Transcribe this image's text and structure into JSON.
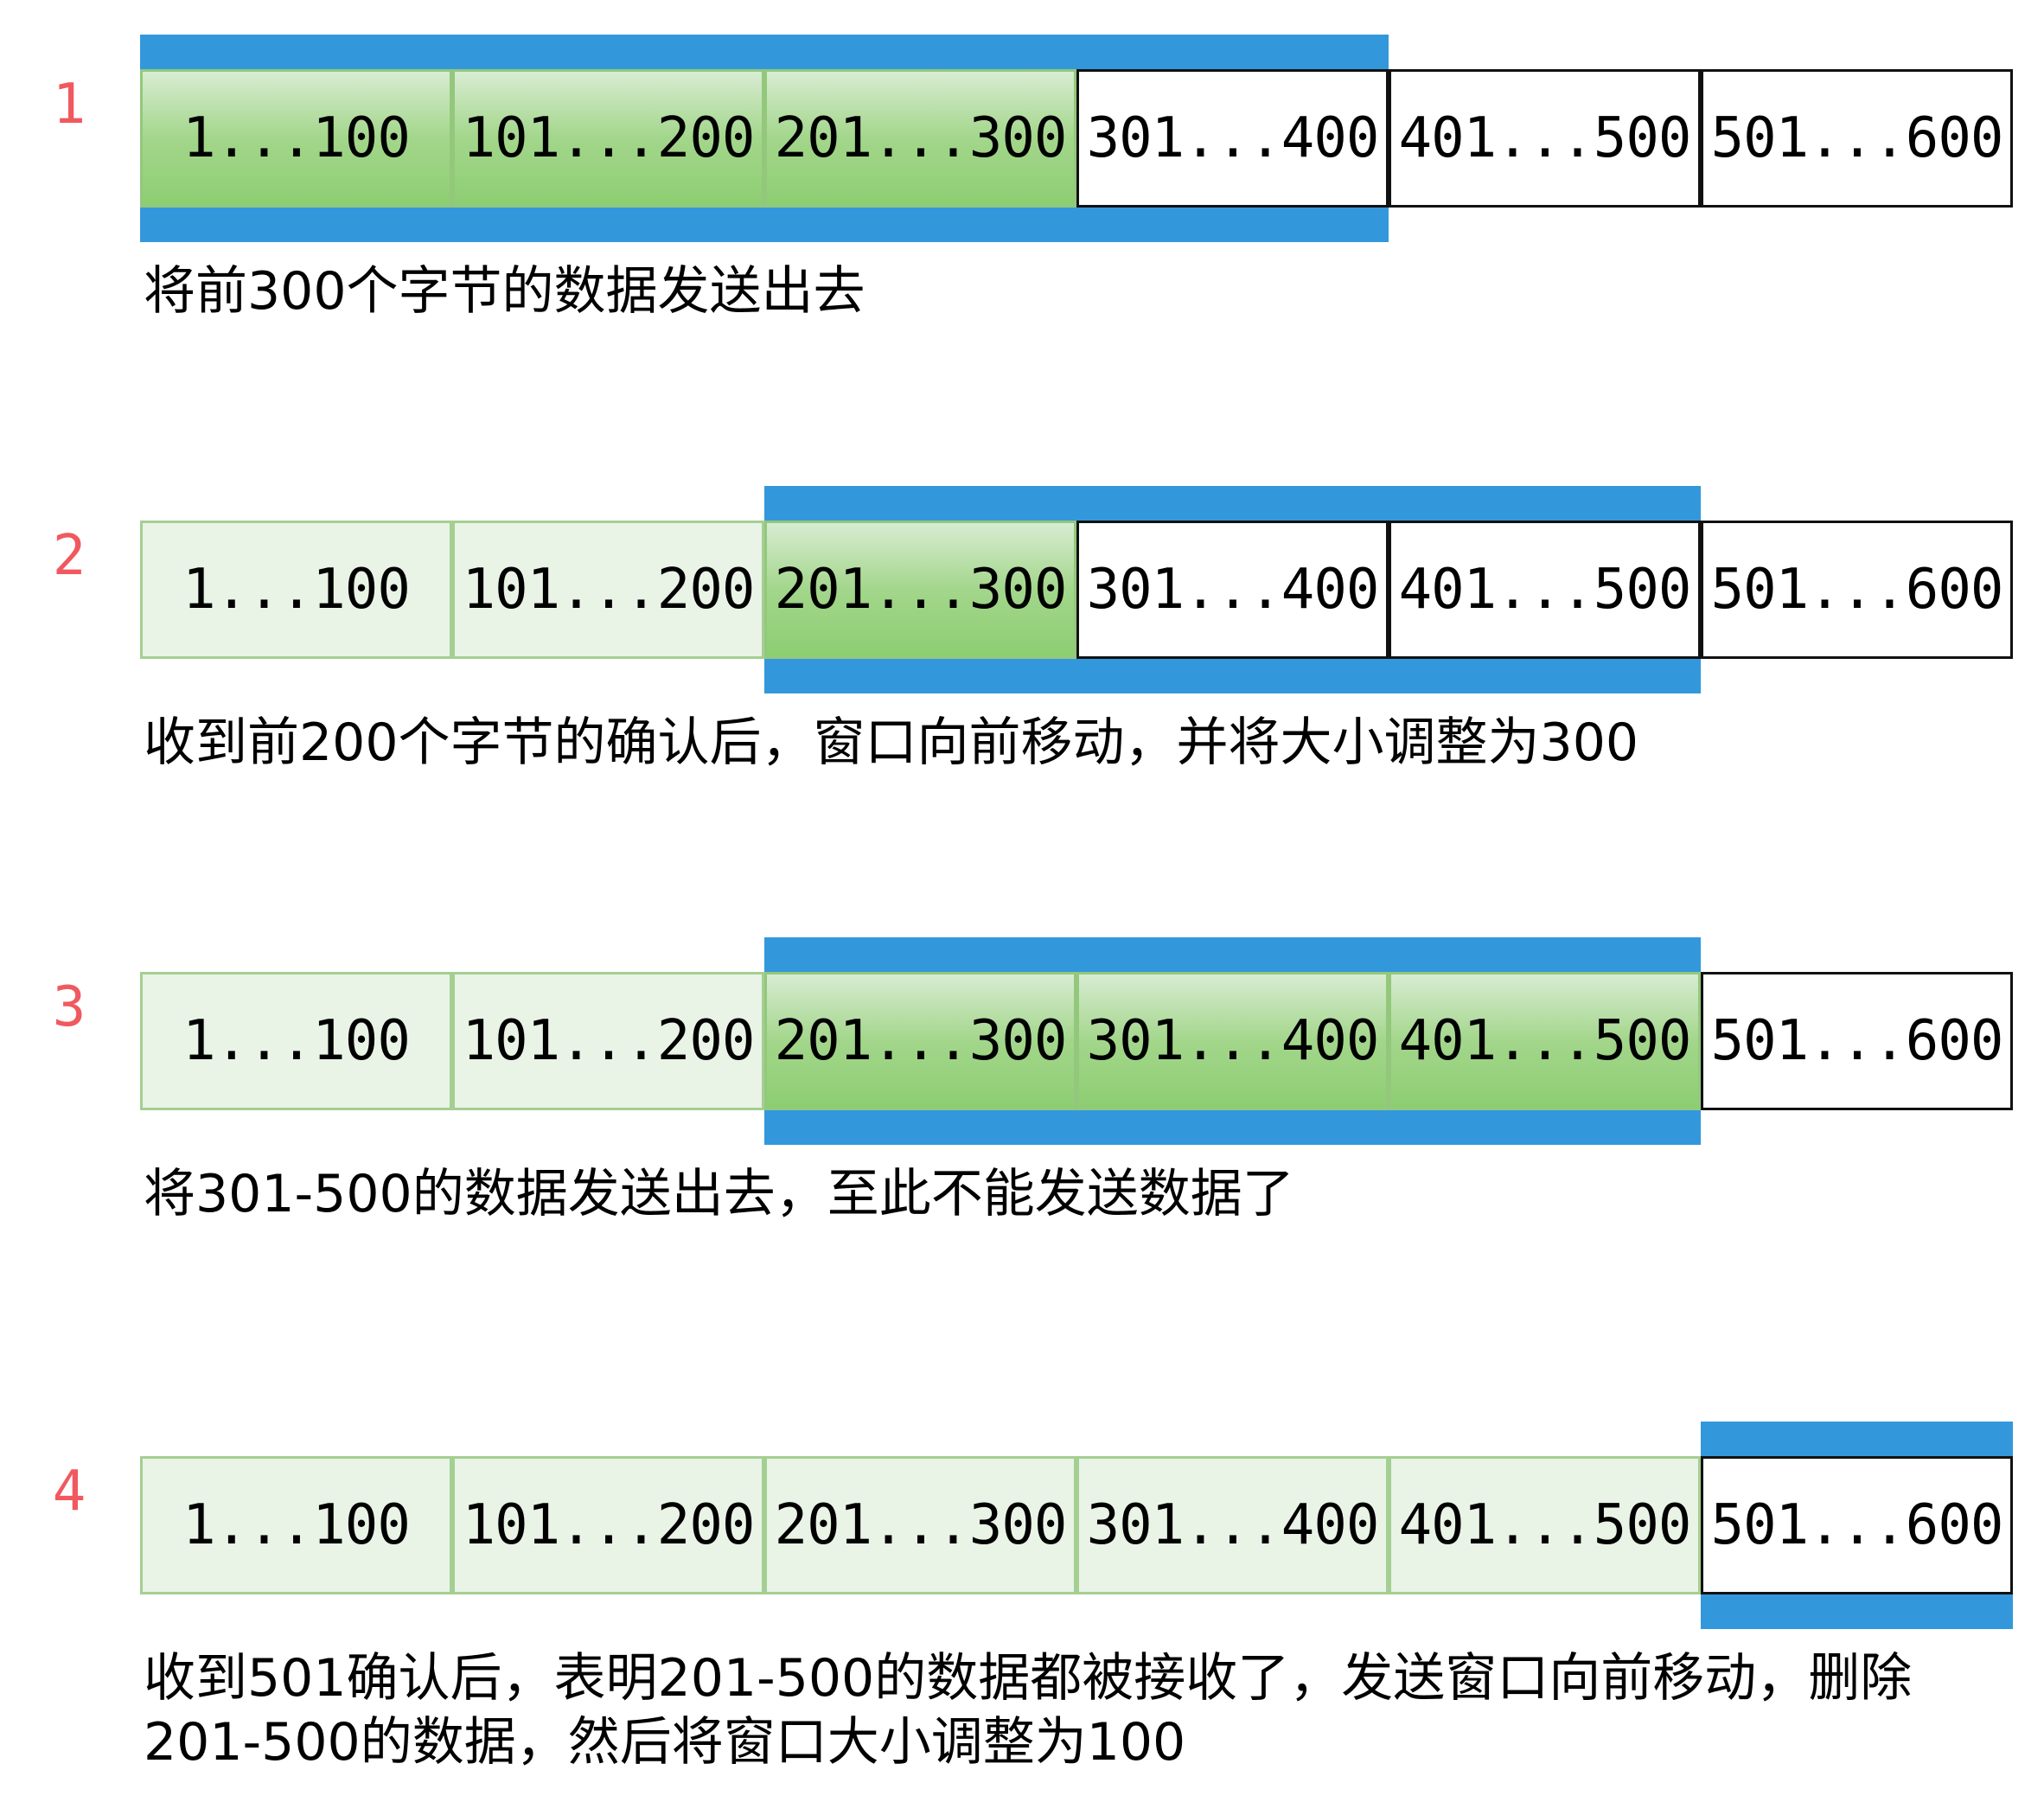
{
  "steps": [
    {
      "number": "1",
      "cells": [
        {
          "label": "1...100",
          "state": "sent"
        },
        {
          "label": "101...200",
          "state": "sent"
        },
        {
          "label": "201...300",
          "state": "sent"
        },
        {
          "label": "301...400",
          "state": "unsent"
        },
        {
          "label": "401...500",
          "state": "unsent"
        },
        {
          "label": "501...600",
          "state": "unsent"
        }
      ],
      "window_cells": [
        0,
        1,
        2,
        3
      ],
      "caption_lines": [
        "将前300个字节的数据发送出去"
      ]
    },
    {
      "number": "2",
      "cells": [
        {
          "label": "1...100",
          "state": "acked"
        },
        {
          "label": "101...200",
          "state": "acked"
        },
        {
          "label": "201...300",
          "state": "sent"
        },
        {
          "label": "301...400",
          "state": "unsent"
        },
        {
          "label": "401...500",
          "state": "unsent"
        },
        {
          "label": "501...600",
          "state": "unsent"
        }
      ],
      "window_cells": [
        2,
        3,
        4
      ],
      "caption_lines": [
        "收到前200个字节的确认后，窗口向前移动，并将大小调整为300"
      ]
    },
    {
      "number": "3",
      "cells": [
        {
          "label": "1...100",
          "state": "acked"
        },
        {
          "label": "101...200",
          "state": "acked"
        },
        {
          "label": "201...300",
          "state": "sent"
        },
        {
          "label": "301...400",
          "state": "sent"
        },
        {
          "label": "401...500",
          "state": "sent"
        },
        {
          "label": "501...600",
          "state": "unsent"
        }
      ],
      "window_cells": [
        2,
        3,
        4
      ],
      "caption_lines": [
        "将301-500的数据发送出去，至此不能发送数据了"
      ]
    },
    {
      "number": "4",
      "cells": [
        {
          "label": "1...100",
          "state": "acked"
        },
        {
          "label": "101...200",
          "state": "acked"
        },
        {
          "label": "201...300",
          "state": "acked"
        },
        {
          "label": "301...400",
          "state": "acked"
        },
        {
          "label": "401...500",
          "state": "acked"
        },
        {
          "label": "501...600",
          "state": "unsent"
        }
      ],
      "window_cells": [
        5
      ],
      "caption_lines": [
        "收到501确认后，表明201-500的数据都被接收了，发送窗口向前移动，删除",
        "201-500的数据，然后将窗口大小调整为100"
      ]
    }
  ],
  "colors": {
    "window_bar": "#3398db",
    "step_number": "#f0595f",
    "sent_fill": "#a3d68b",
    "acked_fill": "#e9f3e6",
    "unsent_fill": "#ffffff"
  }
}
